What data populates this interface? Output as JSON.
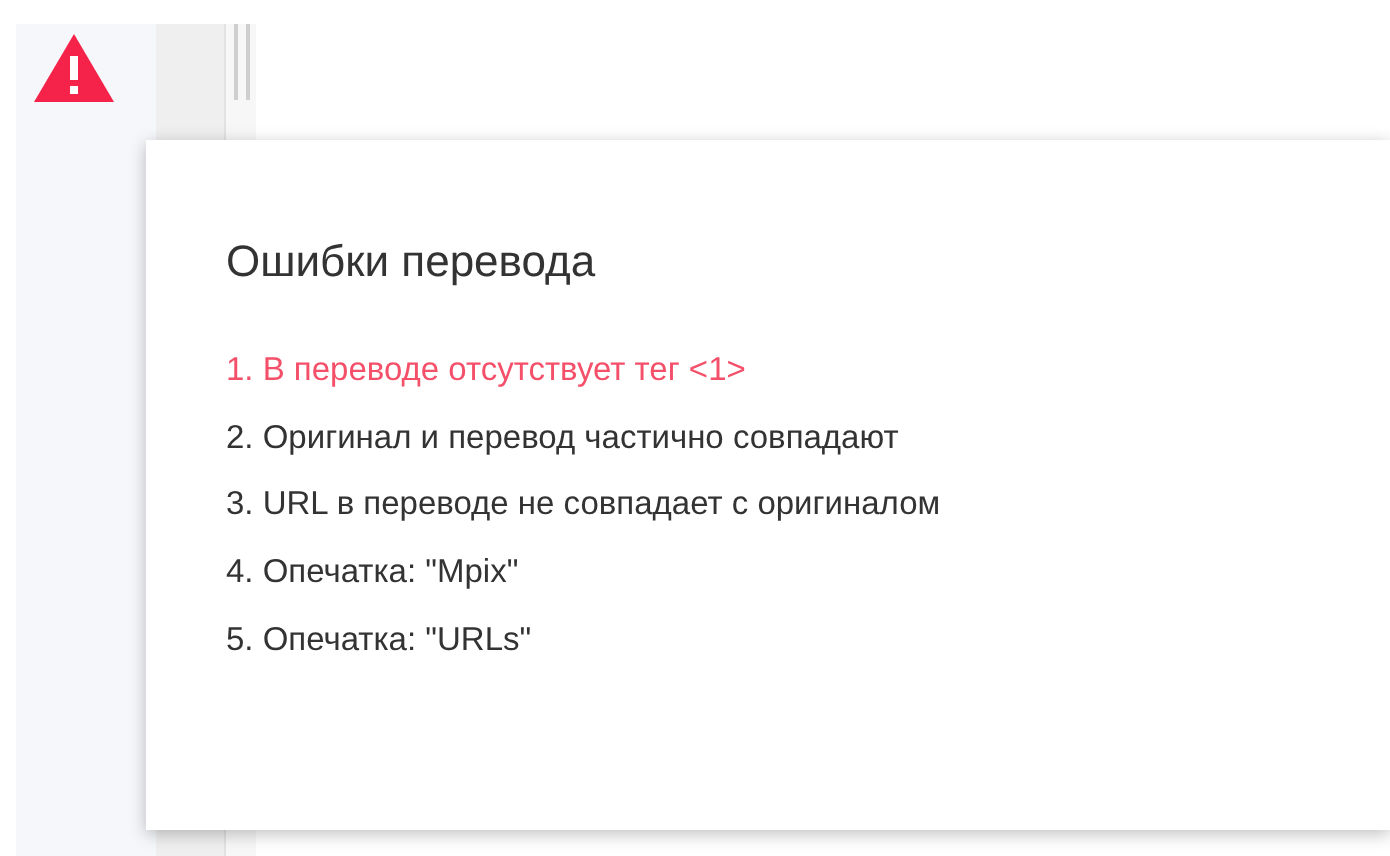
{
  "popup": {
    "title": "Ошибки перевода",
    "errors": [
      {
        "text": "1. В переводе отсутствует тег <1>",
        "highlighted": true
      },
      {
        "text": "2. Оригинал и перевод частично совпадают",
        "highlighted": false
      },
      {
        "text": "3. URL в переводе не совпадает с оригиналом",
        "highlighted": false
      },
      {
        "text": "4. Опечатка: \"Mpix\"",
        "highlighted": false
      },
      {
        "text": "5. Опечатка: \"URLs\"",
        "highlighted": false
      }
    ]
  }
}
